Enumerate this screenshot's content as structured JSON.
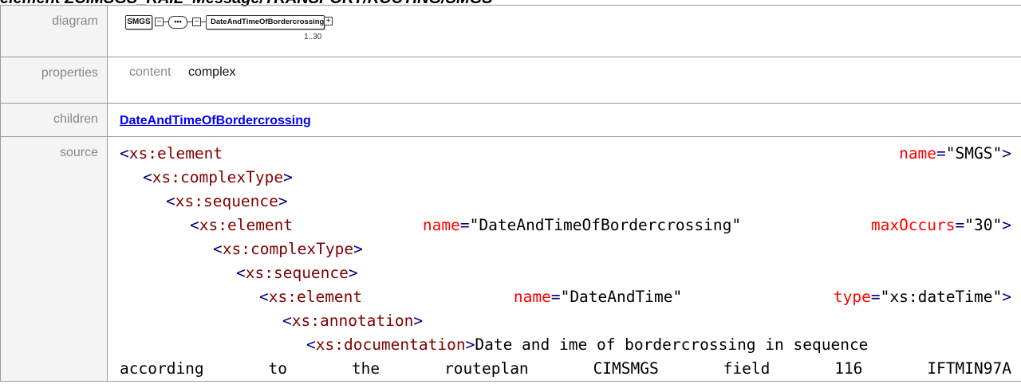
{
  "header": {
    "title": "element ZCIMSGS_RAIL_Message/TRANSPORT/ROUTING/SMGS"
  },
  "labels": {
    "diagram": "diagram",
    "properties": "properties",
    "children": "children",
    "source": "source"
  },
  "diagram": {
    "root": "SMGS",
    "sequence_symbol": "•••",
    "child": "DateAndTimeOfBordercrossing",
    "multiplicity": "1..30"
  },
  "properties": {
    "key": "content",
    "value": "complex"
  },
  "children": {
    "link": "DateAndTimeOfBordercrossing"
  },
  "source": {
    "l1": {
      "open": "<",
      "tag": "xs:element",
      "attr": "name",
      "eq": "=",
      "val": "\"SMGS\"",
      "close": ">"
    },
    "l2": {
      "open": "<",
      "tag": "xs:complexType",
      "close": ">"
    },
    "l3": {
      "open": "<",
      "tag": "xs:sequence",
      "close": ">"
    },
    "l4": {
      "open": "<",
      "tag": "xs:element",
      "attr1": "name",
      "val1": "\"DateAndTimeOfBordercrossing\"",
      "attr2": "maxOccurs",
      "val2": "\"30\"",
      "eq": "=",
      "close": ">"
    },
    "l5": {
      "open": "<",
      "tag": "xs:complexType",
      "close": ">"
    },
    "l6": {
      "open": "<",
      "tag": "xs:sequence",
      "close": ">"
    },
    "l7": {
      "open": "<",
      "tag": "xs:element",
      "attr1": "name",
      "val1": "\"DateAndTime\"",
      "attr2": "type",
      "val2": "\"xs:dateTime\"",
      "eq": "=",
      "close": ">"
    },
    "l8": {
      "open": "<",
      "tag": "xs:annotation",
      "close": ">"
    },
    "l9": {
      "open": "<",
      "tag": "xs:documentation",
      "close": ">",
      "text": "Date and ime of bordercrossing in sequence"
    },
    "l10": {
      "words": [
        "according",
        "to",
        "the",
        "routeplan",
        "CIMSMGS",
        "field",
        "116",
        "IFTMIN97A"
      ]
    }
  },
  "colors": {
    "tag_bracket": "#000080",
    "tag_name": "#800000",
    "attribute": "#ff0000",
    "link": "#0000ee",
    "label": "#888888"
  }
}
